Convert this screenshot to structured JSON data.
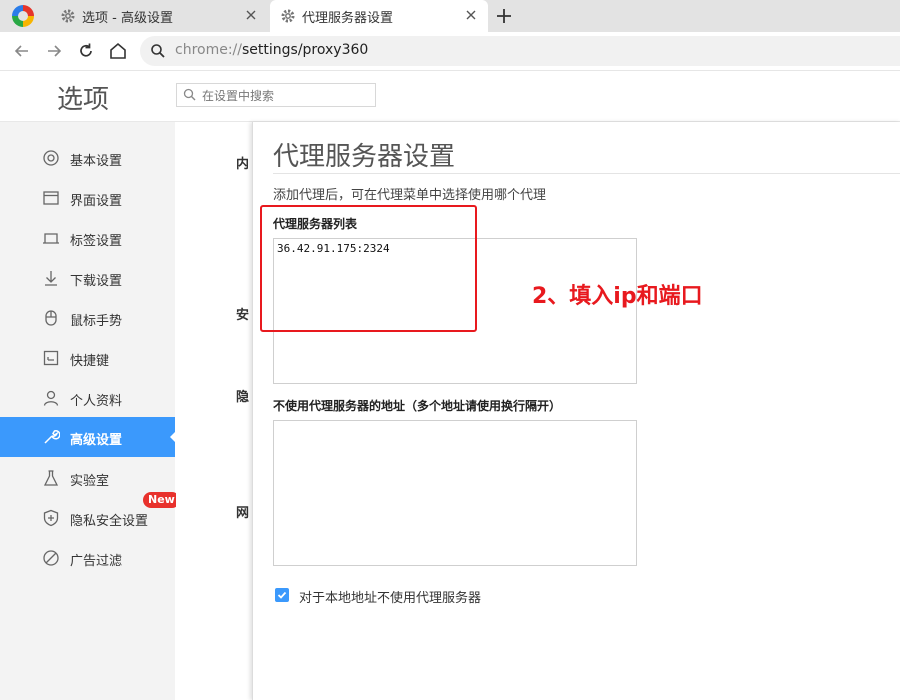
{
  "browser": {
    "tabs": [
      {
        "label": "选项 - 高级设置",
        "active": false
      },
      {
        "label": "代理服务器设置",
        "active": true
      }
    ],
    "url_scheme": "chrome://",
    "url_path": "settings/proxy360"
  },
  "settings": {
    "title": "选项",
    "search_placeholder": "在设置中搜索",
    "sidebar": [
      {
        "label": "基本设置",
        "icon": "target-icon"
      },
      {
        "label": "界面设置",
        "icon": "window-icon"
      },
      {
        "label": "标签设置",
        "icon": "tab-icon"
      },
      {
        "label": "下载设置",
        "icon": "download-icon"
      },
      {
        "label": "鼠标手势",
        "icon": "mouse-icon"
      },
      {
        "label": "快捷键",
        "icon": "shortcut-icon"
      },
      {
        "label": "个人资料",
        "icon": "person-icon"
      },
      {
        "label": "高级设置",
        "icon": "wrench-icon",
        "active": true
      },
      {
        "label": "实验室",
        "icon": "flask-icon"
      },
      {
        "label": "隐私安全设置",
        "icon": "shield-icon",
        "badge": "New"
      },
      {
        "label": "广告过滤",
        "icon": "block-icon"
      }
    ],
    "bg_labels": [
      "内",
      "安",
      "隐",
      "网"
    ]
  },
  "dialog": {
    "title": "代理服务器设置",
    "description": "添加代理后，可在代理菜单中选择使用哪个代理",
    "proxy_list_label": "代理服务器列表",
    "proxy_list_value": "36.42.91.175:2324",
    "bypass_label": "不使用代理服务器的地址（多个地址请使用换行隔开）",
    "bypass_value": "",
    "local_checkbox_label": "对于本地地址不使用代理服务器",
    "local_checkbox_checked": true
  },
  "annotation": {
    "text": "2、填入ip和端口",
    "color": "#e8191e"
  },
  "colors": {
    "accent": "#3b99fc"
  }
}
